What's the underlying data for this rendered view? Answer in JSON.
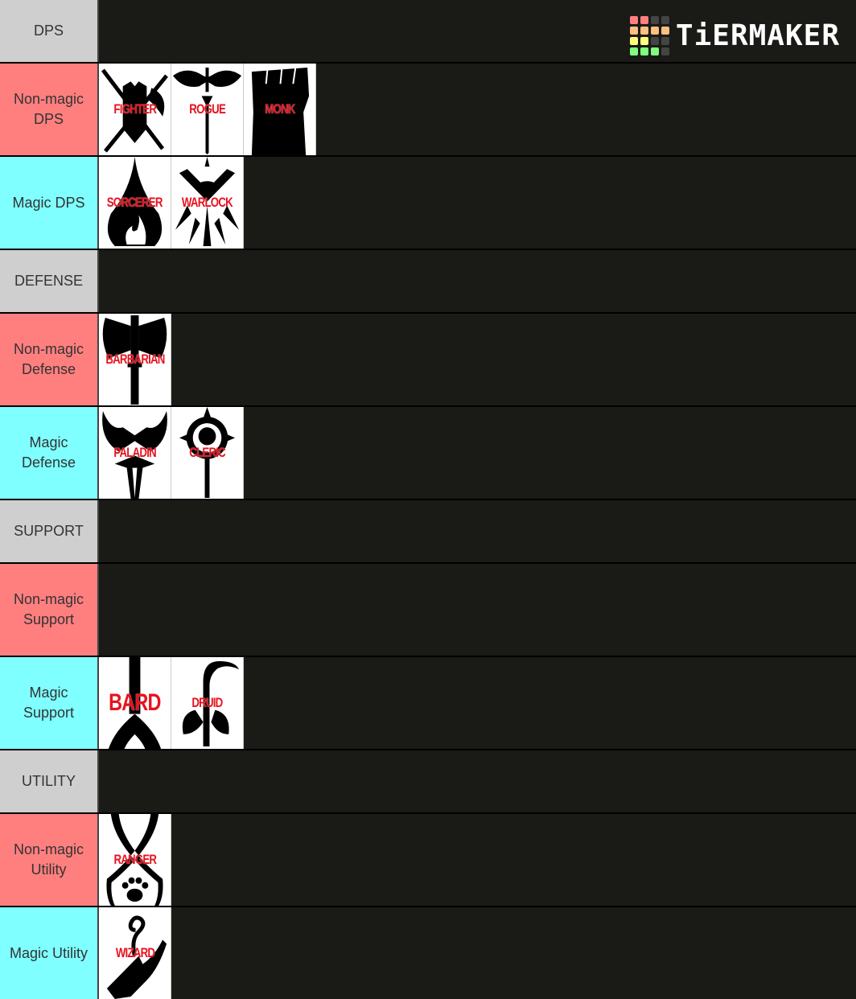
{
  "logo": {
    "text": "TiERMAKER",
    "grid_colors": [
      "#ff7f7f",
      "#ff7f7f",
      "#444444",
      "#444444",
      "#ffbf7f",
      "#ffbf7f",
      "#ffbf7f",
      "#ffbf7f",
      "#ffff7f",
      "#ffff7f",
      "#444444",
      "#444444",
      "#7fff7f",
      "#7fff7f",
      "#7fff7f",
      "#444444"
    ]
  },
  "colors": {
    "header": "#cfcfcf",
    "nonmagic": "#ff7f7f",
    "magic": "#7fffff",
    "row_bg": "#1a1a17",
    "item_text": "#e8121e"
  },
  "tiers": [
    {
      "label": "DPS",
      "kind": "header",
      "items": []
    },
    {
      "label": "Non-magic DPS",
      "kind": "nonmagic",
      "items": [
        {
          "name": "FIGHTER",
          "icon": "shield-crossed-weapons-icon"
        },
        {
          "name": "ROGUE",
          "icon": "mask-dagger-icon"
        },
        {
          "name": "MONK",
          "icon": "fist-icon"
        }
      ]
    },
    {
      "label": "Magic DPS",
      "kind": "magic",
      "items": [
        {
          "name": "SORCERER",
          "icon": "flame-drop-icon"
        },
        {
          "name": "WARLOCK",
          "icon": "eye-rays-icon"
        }
      ]
    },
    {
      "label": "DEFENSE",
      "kind": "header",
      "items": []
    },
    {
      "label": "Non-magic Defense",
      "kind": "nonmagic",
      "items": [
        {
          "name": "BARBARIAN",
          "icon": "double-axe-icon"
        }
      ]
    },
    {
      "label": "Magic Defense",
      "kind": "magic",
      "items": [
        {
          "name": "PALADIN",
          "icon": "winged-sword-icon"
        },
        {
          "name": "CLERIC",
          "icon": "sun-mace-icon"
        }
      ]
    },
    {
      "label": "SUPPORT",
      "kind": "header",
      "items": []
    },
    {
      "label": "Non-magic Support",
      "kind": "nonmagic",
      "items": []
    },
    {
      "label": "Magic Support",
      "kind": "magic",
      "items": [
        {
          "name": "BARD",
          "icon": "lute-icon"
        },
        {
          "name": "DRUID",
          "icon": "crook-staff-leaves-icon"
        }
      ]
    },
    {
      "label": "UTILITY",
      "kind": "header",
      "items": []
    },
    {
      "label": "Non-magic Utility",
      "kind": "nonmagic",
      "items": [
        {
          "name": "RANGER",
          "icon": "bow-paw-icon"
        }
      ]
    },
    {
      "label": "Magic Utility",
      "kind": "magic",
      "items": [
        {
          "name": "WIZARD",
          "icon": "hand-spiral-icon"
        }
      ]
    }
  ]
}
